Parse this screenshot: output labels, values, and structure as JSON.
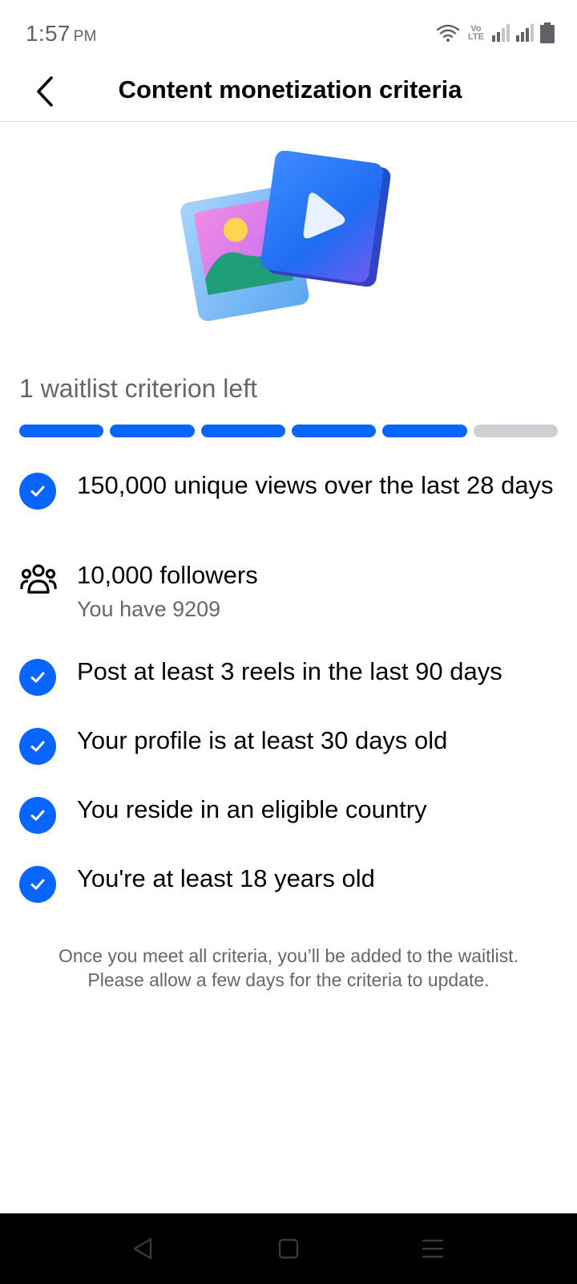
{
  "status_bar": {
    "time": "1:57",
    "ampm": "PM",
    "volte_top": "Vo",
    "volte_bottom": "LTE"
  },
  "header": {
    "title": "Content monetization criteria"
  },
  "waitlist": {
    "heading": "1 waitlist criterion left",
    "progress_total": 6,
    "progress_done": 5
  },
  "criteria": [
    {
      "label": "150,000 unique views over the last 28 days",
      "status": "met",
      "icon": "check-circle-icon"
    },
    {
      "label": "10,000 followers",
      "detail": "You have 9209",
      "status": "not_met",
      "icon": "followers-icon"
    },
    {
      "label": "Post at least 3 reels in the last 90 days",
      "status": "met",
      "icon": "check-circle-icon"
    },
    {
      "label": "Your profile is at least 30 days old",
      "status": "met",
      "icon": "check-circle-icon"
    },
    {
      "label": "You reside in an eligible country",
      "status": "met",
      "icon": "check-circle-icon"
    },
    {
      "label": "You're at least 18 years old",
      "status": "met",
      "icon": "check-circle-icon"
    }
  ],
  "footnote": {
    "line1": "Once you meet all criteria, you’ll be added to the waitlist.",
    "line2": "Please allow a few days for the criteria to update."
  },
  "colors": {
    "accent": "#0866ff",
    "progress_empty": "#ccd0d5",
    "secondary_text": "#65676b"
  }
}
